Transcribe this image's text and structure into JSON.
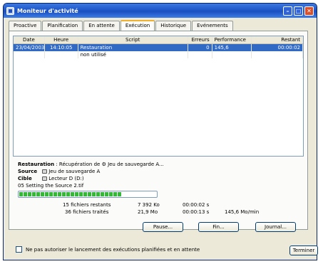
{
  "window": {
    "title": "Moniteur d'activité",
    "minimize": "–",
    "maximize": "□",
    "close": "✕"
  },
  "tabs": [
    {
      "label": "Proactive"
    },
    {
      "label": "Planification"
    },
    {
      "label": "En attente"
    },
    {
      "label": "Exécution"
    },
    {
      "label": "Historique"
    },
    {
      "label": "Evénements"
    }
  ],
  "grid": {
    "headers": [
      "Date",
      "Heure",
      "Script",
      "Erreurs",
      "Performance",
      "Restant"
    ],
    "rows": [
      {
        "date": "23/04/2003",
        "heure": "14:10:05",
        "script": "Restauration",
        "erreurs": "0",
        "performance": "145,6",
        "restant": "00:00:02"
      },
      {
        "date": "",
        "heure": "",
        "script": "non utilisé",
        "erreurs": "",
        "performance": "",
        "restant": ""
      }
    ]
  },
  "details": {
    "restauration_label": "Restauration",
    "restauration_value": ": Récupération de ⚙ Jeu de sauvegarde A...",
    "source_label": "Source",
    "source_value": "Jeu de sauvegarde A",
    "cible_label": "Cible",
    "cible_value": "Lecteur D (D:)",
    "current_file": "05 Setting the Source 2.tif"
  },
  "progress": {
    "fraction": 0.75
  },
  "stats": {
    "files_remaining": "15 fichiers restants",
    "size_remaining": "7 392 Ko",
    "time_remaining": "00:00:02 s",
    "files_done": "36 fichiers traités",
    "size_done": "21,9 Mo",
    "time_elapsed": "00:00:13 s",
    "speed": "145,6 Mo/min"
  },
  "buttons": {
    "pause": "Pause...",
    "fin": "Fin...",
    "journal": "Journal...",
    "terminer": "Terminer"
  },
  "footer": {
    "checkbox_label": "Ne pas autoriser le lancement des exécutions planifiées et en attente",
    "checked": false
  }
}
